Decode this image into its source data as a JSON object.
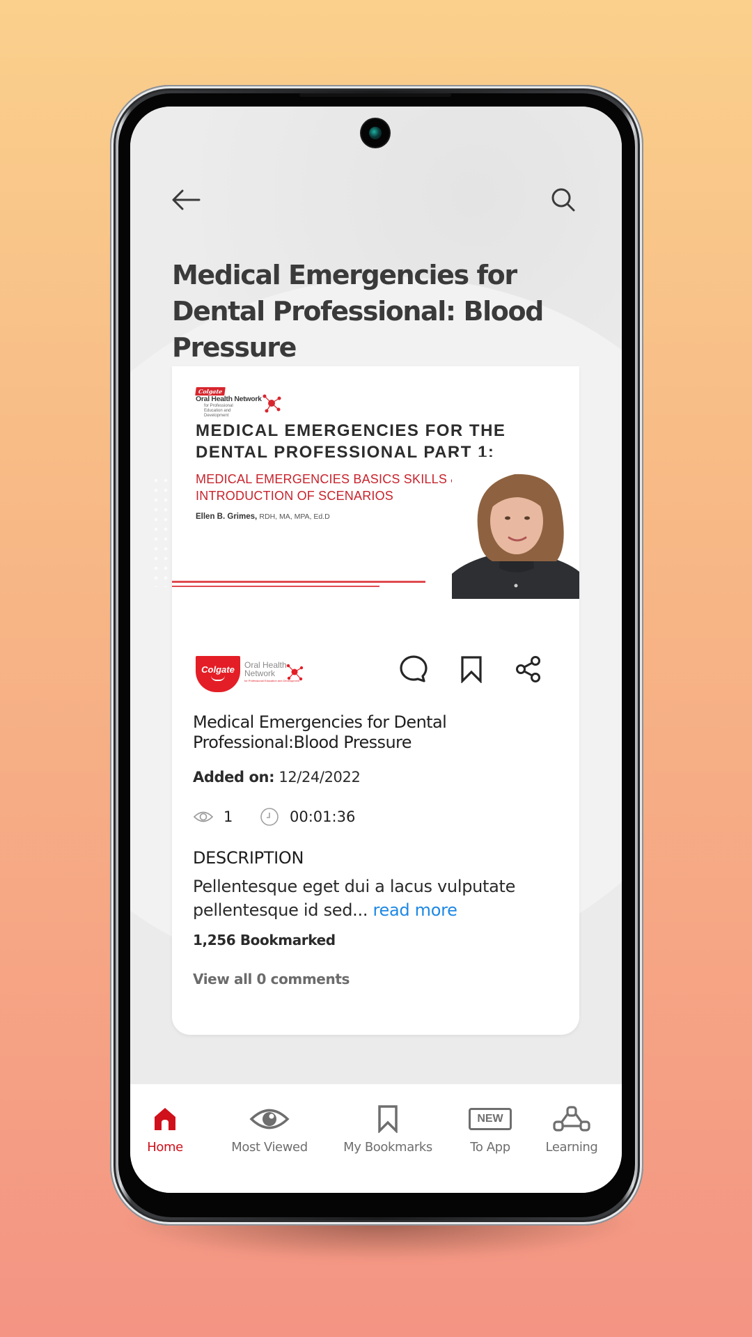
{
  "header": {
    "back_icon": "arrow-left-icon",
    "search_icon": "search-icon",
    "title": "Medical Emergencies for Dental Professional: Blood Pressure"
  },
  "thumbnail": {
    "logo_badge": "Colgate",
    "logo_name": "Oral Health Network",
    "logo_sub": "for Professional Education and Development",
    "heading": "MEDICAL EMERGENCIES FOR THE DENTAL PROFESSIONAL PART 1:",
    "subheading": "MEDICAL EMERGENCIES BASICS SKILLS & INTRODUCTION OF SCENARIOS",
    "author_name": "Ellen B. Grimes,",
    "author_credentials": "RDH, MA, MPA, Ed.D"
  },
  "brand": {
    "shield_text": "Colgate",
    "network_line1": "Oral Health",
    "network_line2": "Network",
    "network_sub": "for Professional Education and Development"
  },
  "actions": {
    "comment_icon": "comment-icon",
    "bookmark_icon": "bookmark-icon",
    "share_icon": "share-icon"
  },
  "content": {
    "title": "Medical Emergencies for Dental Professional:Blood Pressure",
    "added_label": "Added on:",
    "added_date": "12/24/2022",
    "views": "1",
    "duration": "00:01:36",
    "description_heading": "DESCRIPTION",
    "description_text": "Pellentesque eget dui a lacus vulputate pellentesque id sed...",
    "read_more": "read more",
    "bookmarked": "1,256 Bookmarked",
    "view_comments": "View all 0 comments"
  },
  "bottom_nav": {
    "active_color": "#D0101A",
    "items": [
      {
        "label": "Home",
        "icon": "home-icon",
        "active": true
      },
      {
        "label": "Most Viewed",
        "icon": "eye-icon",
        "active": false
      },
      {
        "label": "My Bookmarks",
        "icon": "bookmark-icon",
        "active": false
      },
      {
        "label": "To App",
        "icon": "new-badge-icon",
        "badge_text": "NEW",
        "active": false
      },
      {
        "label": "Learning",
        "icon": "network-nodes-icon",
        "active": false
      }
    ]
  }
}
